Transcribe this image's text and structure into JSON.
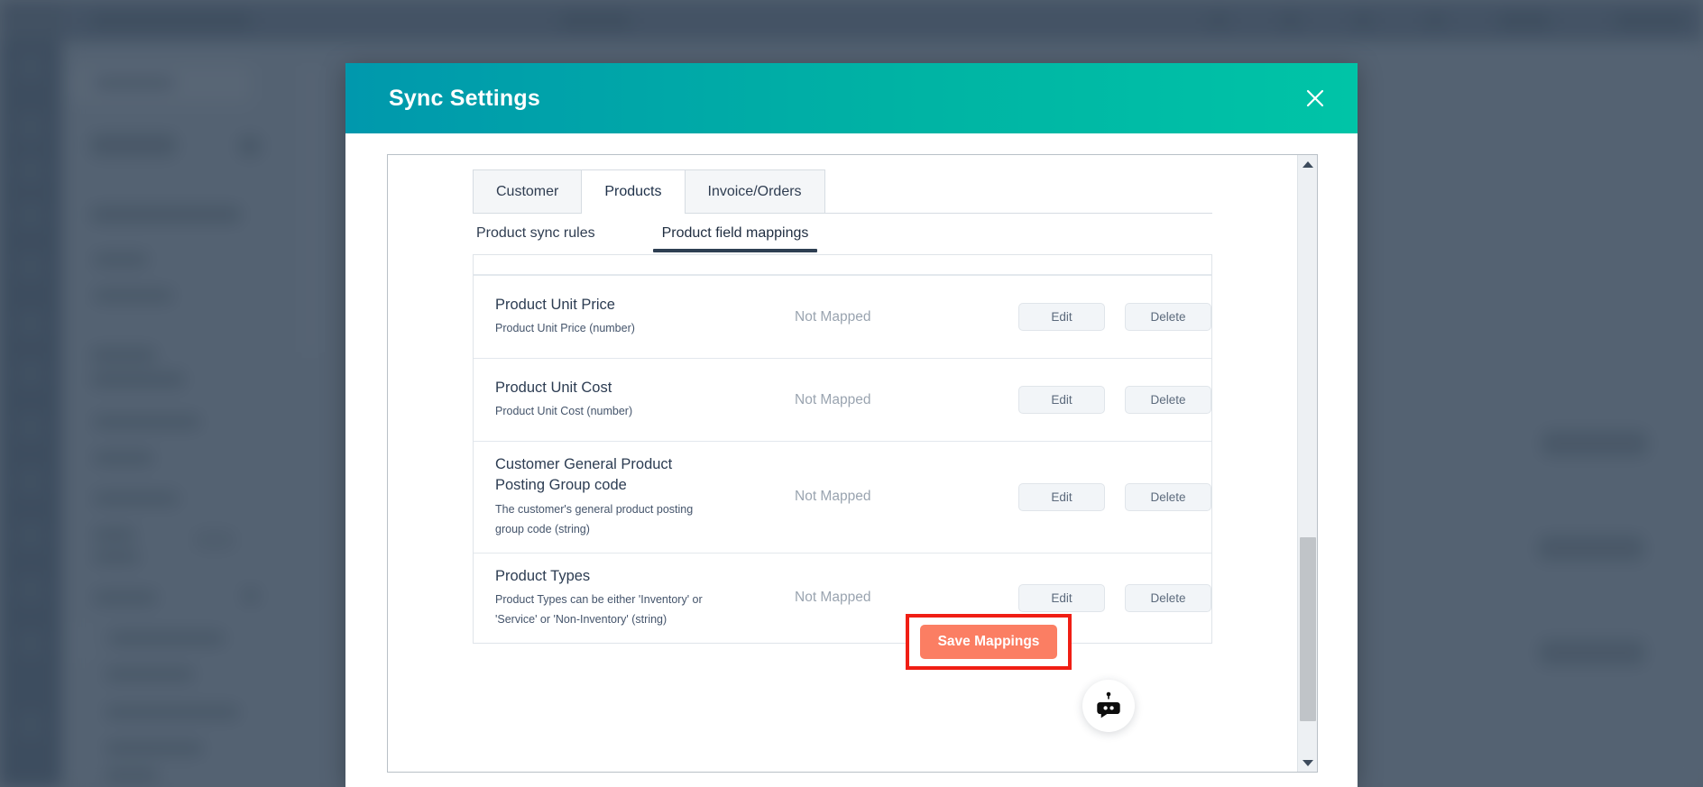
{
  "backdrop": {
    "description": "blurred dimmed application page behind modal"
  },
  "modal": {
    "title": "Sync Settings",
    "close_icon": "close-icon",
    "main_tabs": [
      {
        "label": "Customer",
        "active": false
      },
      {
        "label": "Products",
        "active": true
      },
      {
        "label": "Invoice/Orders",
        "active": false
      }
    ],
    "sub_tabs": [
      {
        "label": "Product sync rules",
        "active": false
      },
      {
        "label": "Product field mappings",
        "active": true
      }
    ],
    "table": {
      "rows": [
        {
          "field": "Product Unit Price",
          "description": "Product Unit Price (number)",
          "status": "Not Mapped",
          "edit_label": "Edit",
          "delete_label": "Delete"
        },
        {
          "field": "Product Unit Cost",
          "description": "Product Unit Cost (number)",
          "status": "Not Mapped",
          "edit_label": "Edit",
          "delete_label": "Delete"
        },
        {
          "field": "Customer General Product Posting Group code",
          "description": "The customer's general product posting group code (string)",
          "status": "Not Mapped",
          "edit_label": "Edit",
          "delete_label": "Delete"
        },
        {
          "field": "Product Types",
          "description": "Product Types can be either 'Inventory' or 'Service' or 'Non-Inventory' (string)",
          "status": "Not Mapped",
          "edit_label": "Edit",
          "delete_label": "Delete"
        }
      ]
    },
    "save_button": {
      "label": "Save Mappings",
      "highlighted": true,
      "highlight_color": "#f01e14",
      "background_color": "#fb7e63"
    },
    "scrollbar": {
      "up_arrow_icon": "chevron-up-icon",
      "down_arrow_icon": "chevron-down-icon"
    },
    "chat_launcher": {
      "icon": "chat-bot-icon"
    },
    "colors": {
      "header_gradient_start": "#0098ad",
      "header_gradient_end": "#00c4a7",
      "accent_dark": "#2e3f52",
      "text_primary": "#2c3c52",
      "text_muted": "#9aa4b0"
    }
  }
}
